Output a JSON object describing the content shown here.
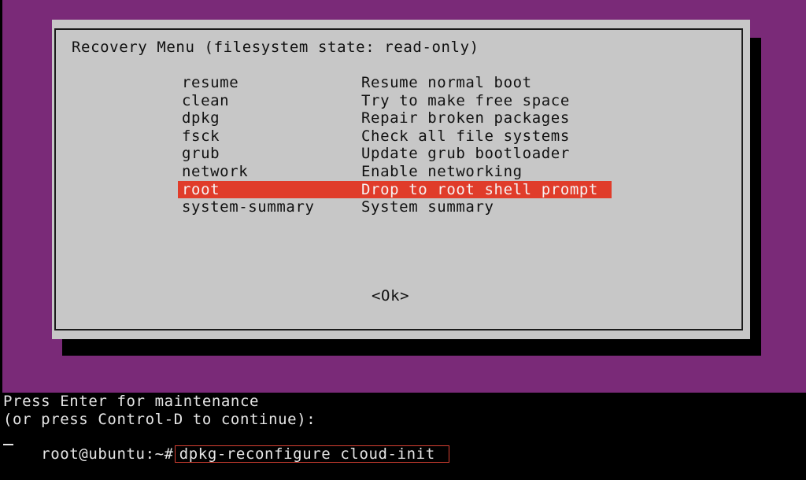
{
  "dialog": {
    "title": "Recovery Menu (filesystem state: read-only)",
    "items": [
      {
        "key": "resume",
        "desc": "Resume normal boot"
      },
      {
        "key": "clean",
        "desc": "Try to make free space"
      },
      {
        "key": "dpkg",
        "desc": "Repair broken packages"
      },
      {
        "key": "fsck",
        "desc": "Check all file systems"
      },
      {
        "key": "grub",
        "desc": "Update grub bootloader"
      },
      {
        "key": "network",
        "desc": "Enable networking"
      },
      {
        "key": "root",
        "desc": "Drop to root shell prompt"
      },
      {
        "key": "system-summary",
        "desc": "System summary"
      }
    ],
    "selected_item": "root",
    "ok_label": "<Ok>"
  },
  "console": {
    "line1": "Press Enter for maintenance",
    "line2": "(or press Control-D to continue):",
    "prompt": "root@ubuntu:~#",
    "command": "dpkg-reconfigure cloud-init"
  },
  "colors": {
    "background": "#7a2a78",
    "dialog": "#c7c7c7",
    "selection": "#e03c2a",
    "command_highlight_border": "#d64032"
  }
}
